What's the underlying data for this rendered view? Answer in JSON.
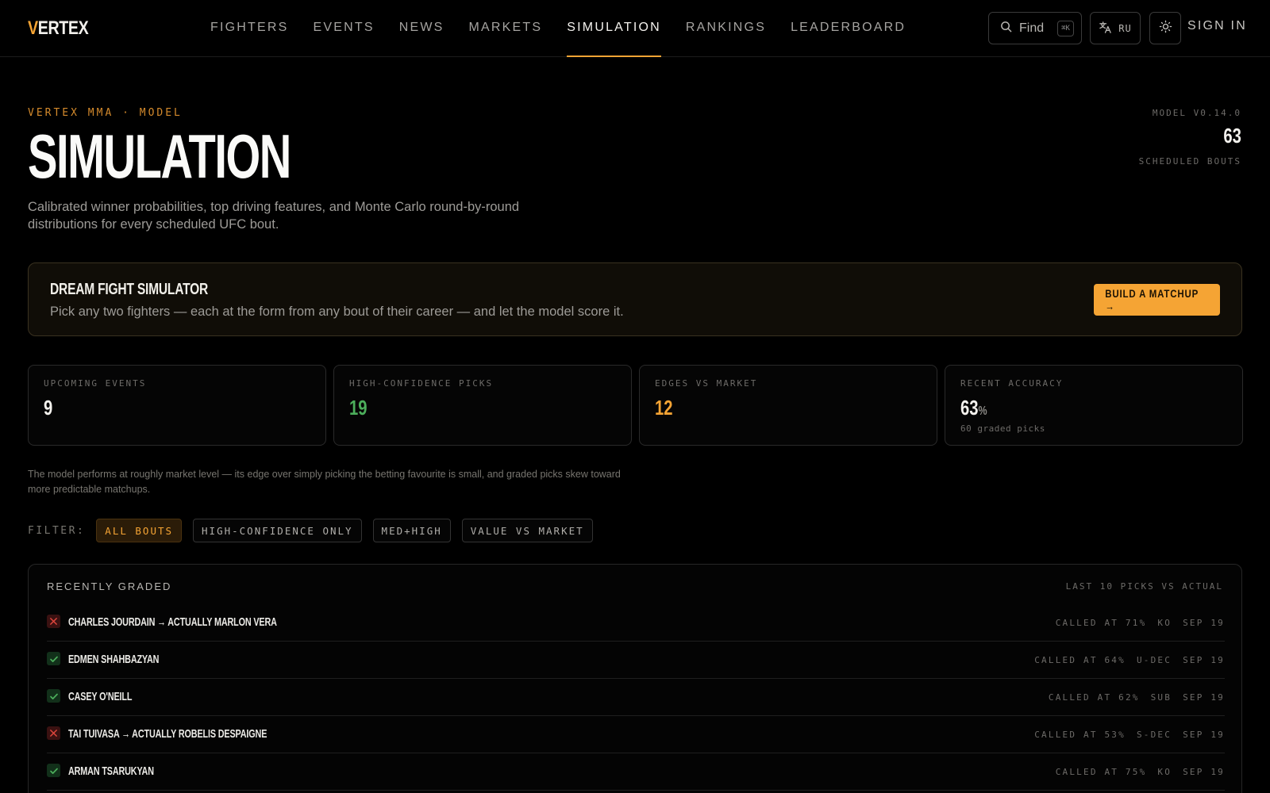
{
  "brand": {
    "logo_first": "V",
    "logo_rest": "ERTEX",
    "accent_color": "#f5a434"
  },
  "nav": {
    "links": [
      "FIGHTERS",
      "EVENTS",
      "NEWS",
      "MARKETS",
      "SIMULATION",
      "RANKINGS",
      "LEADERBOARD"
    ],
    "active": "SIMULATION",
    "find_label": "Find",
    "find_shortcut": "⌘K",
    "lang_label": "RU",
    "signin_label": "SIGN IN"
  },
  "header": {
    "eyebrow": "VERTEX MMA · MODEL",
    "title": "SIMULATION",
    "subtitle": "Calibrated winner probabilities, top driving features, and Monte Carlo round-by-round distributions for every scheduled UFC bout.",
    "model_version": "MODEL V0.14.0",
    "scheduled_count": "63",
    "scheduled_label": "SCHEDULED BOUTS"
  },
  "dream": {
    "title": "DREAM FIGHT SIMULATOR",
    "description": "Pick any two fighters — each at the form from any bout of their career — and let the model score it.",
    "button_label": "BUILD A MATCHUP →"
  },
  "stats": [
    {
      "label": "UPCOMING EVENTS",
      "value": "9",
      "suffix": "",
      "sub": "",
      "color": "#f4f2ee"
    },
    {
      "label": "HIGH-CONFIDENCE PICKS",
      "value": "19",
      "suffix": "",
      "sub": "",
      "color": "#4cae5b"
    },
    {
      "label": "EDGES VS MARKET",
      "value": "12",
      "suffix": "",
      "sub": "",
      "color": "#f5a434"
    },
    {
      "label": "RECENT ACCURACY",
      "value": "63",
      "suffix": "%",
      "sub": "60 graded picks",
      "color": "#f4f2ee"
    }
  ],
  "note": "The model performs at roughly market level — its edge over simply picking the betting favourite is small, and graded picks skew toward more predictable matchups.",
  "filter": {
    "label": "FILTER:",
    "chips": [
      "ALL BOUTS",
      "HIGH-CONFIDENCE ONLY",
      "MED+HIGH",
      "VALUE VS MARKET"
    ],
    "active": "ALL BOUTS"
  },
  "graded": {
    "title": "RECENTLY GRADED",
    "meta": "LAST 10 PICKS VS ACTUAL",
    "rows": [
      {
        "result": "wrong",
        "name": "CHARLES JOURDAIN → ACTUALLY MARLON VERA",
        "called": "CALLED AT 71%",
        "method": "KO",
        "date": "SEP 19"
      },
      {
        "result": "right",
        "name": "EDMEN SHAHBAZYAN",
        "called": "CALLED AT 64%",
        "method": "U-DEC",
        "date": "SEP 19"
      },
      {
        "result": "right",
        "name": "CASEY O'NEILL",
        "called": "CALLED AT 62%",
        "method": "SUB",
        "date": "SEP 19"
      },
      {
        "result": "wrong",
        "name": "TAI TUIVASA → ACTUALLY ROBELIS DESPAIGNE",
        "called": "CALLED AT 53%",
        "method": "S-DEC",
        "date": "SEP 19"
      },
      {
        "result": "right",
        "name": "ARMAN TSARUKYAN",
        "called": "CALLED AT 75%",
        "method": "KO",
        "date": "SEP 19"
      }
    ]
  }
}
